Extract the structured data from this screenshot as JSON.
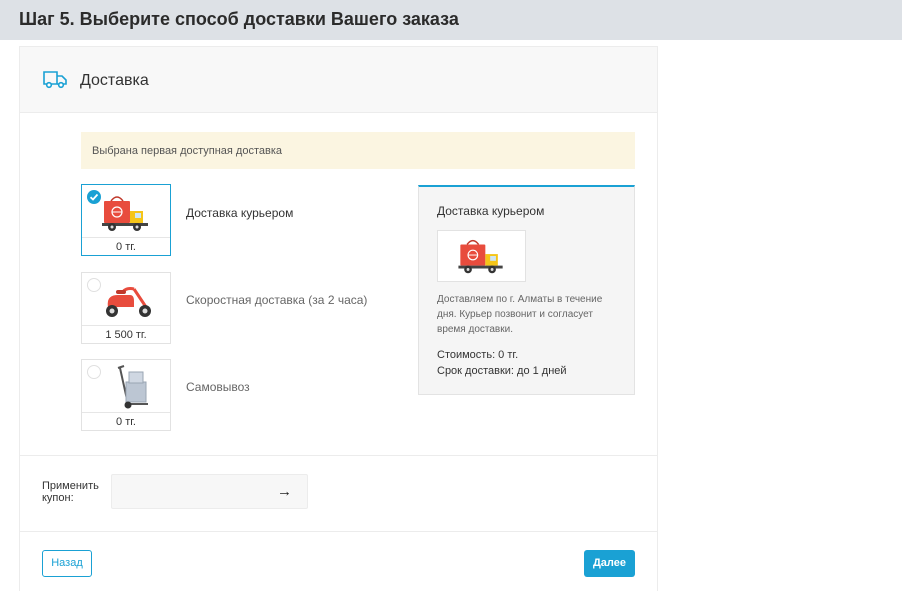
{
  "header": {
    "title": "Шаг 5. Выберите способ доставки Вашего заказа"
  },
  "panel": {
    "title": "Доставка",
    "icon": "truck-icon"
  },
  "notice": {
    "text": "Выбрана первая доступная доставка"
  },
  "options": [
    {
      "label": "Доставка курьером",
      "price": "0 тг.",
      "icon": "courier-truck-icon",
      "selected": true
    },
    {
      "label": "Скоростная доставка (за 2 часа)",
      "price": "1 500 тг.",
      "icon": "scooter-icon",
      "selected": false
    },
    {
      "label": "Самовывоз",
      "price": "0 тг.",
      "icon": "hand-truck-icon",
      "selected": false
    }
  ],
  "detail": {
    "title": "Доставка курьером",
    "icon": "courier-truck-icon",
    "description": "Доставляем по г. Алматы в течение дня. Курьер позвонит и согласует время доставки.",
    "cost": "Стоимость: 0 тг.",
    "term": "Срок доставки: до 1 дней"
  },
  "coupon": {
    "label": "Применить купон:",
    "value": "",
    "submit_icon": "arrow-right-icon"
  },
  "buttons": {
    "back": "Назад",
    "next": "Далее"
  },
  "colors": {
    "accent": "#1aa1d4",
    "notice_bg": "#fbf5e1",
    "truck_body": "#e84c3d",
    "truck_cab": "#f5c518"
  }
}
